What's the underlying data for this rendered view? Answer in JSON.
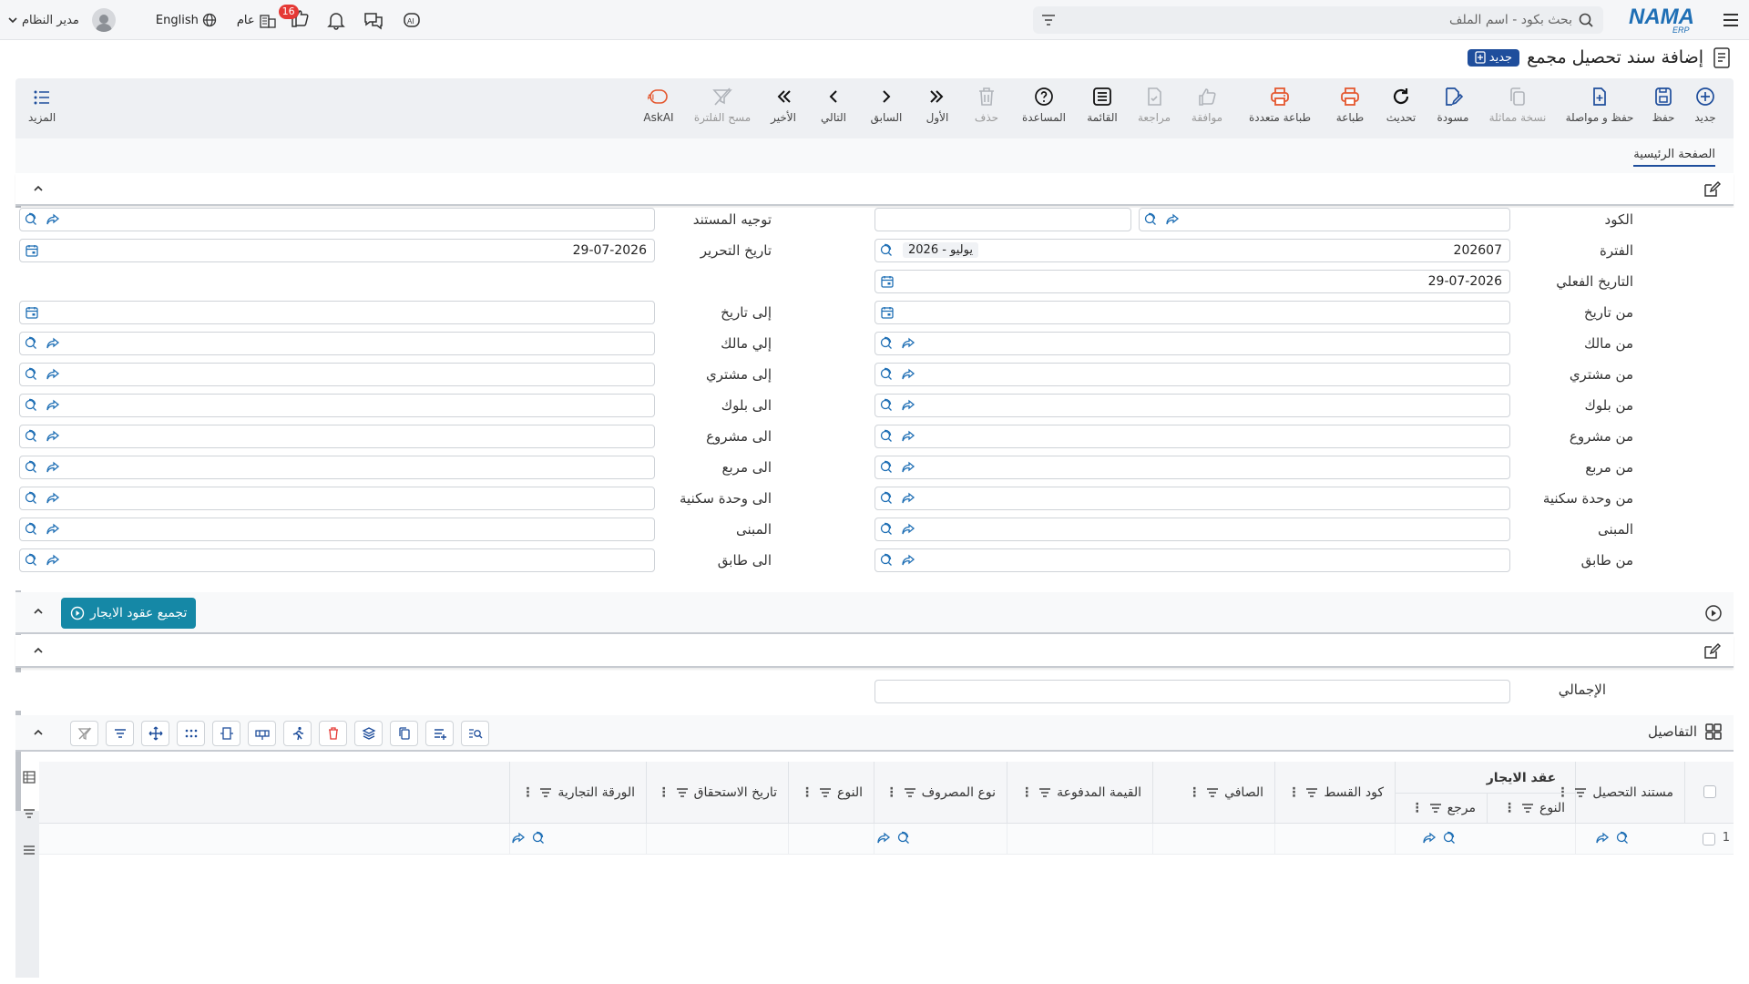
{
  "app": {
    "logo_text": "NAMA",
    "logo_sub": "ERP",
    "search_placeholder": "بحث بكود - اسم الملف",
    "user_name": "مدير النظام",
    "language": "English",
    "company": "عام",
    "likes_count": "16",
    "brand_color": "#1f4e9c"
  },
  "page": {
    "title": "إضافة سند تحصيل مجمع",
    "new_badge": "جديد"
  },
  "toolbar": {
    "items": [
      {
        "label": "جديد",
        "icon": "plus-circle-icon"
      },
      {
        "label": "حفظ",
        "icon": "save-icon"
      },
      {
        "label": "حفظ و مواصلة",
        "icon": "save-continue-icon"
      },
      {
        "label": "نسخة مماثلة",
        "icon": "copy-icon"
      },
      {
        "label": "مسودة",
        "icon": "draft-icon"
      },
      {
        "label": "تحديث",
        "icon": "refresh-icon"
      },
      {
        "label": "طباعة",
        "icon": "print-icon"
      },
      {
        "label": "طباعة متعددة",
        "icon": "multi-print-icon"
      },
      {
        "label": "موافقة",
        "icon": "approve-icon"
      },
      {
        "label": "مراجعة",
        "icon": "review-icon"
      },
      {
        "label": "القائمة",
        "icon": "list-icon"
      },
      {
        "label": "المساعدة",
        "icon": "help-icon"
      },
      {
        "label": "حذف",
        "icon": "trash-icon"
      },
      {
        "label": "الأول",
        "icon": "first-icon"
      },
      {
        "label": "السابق",
        "icon": "prev-icon"
      },
      {
        "label": "التالي",
        "icon": "next-icon"
      },
      {
        "label": "الأخير",
        "icon": "last-icon"
      },
      {
        "label": "مسح الفلترة",
        "icon": "clear-filter-icon"
      },
      {
        "label": "AskAI",
        "icon": "ai-icon"
      }
    ],
    "more_label": "المزيد"
  },
  "tabs": {
    "main": "الصفحة الرئيسية"
  },
  "form": {
    "right": [
      {
        "label": "الكود",
        "value": ""
      },
      {
        "label": "الفترة",
        "value": "202607",
        "tag": "2026 - يوليو"
      },
      {
        "label": "التاريخ الفعلي",
        "value": "29-07-2026"
      },
      {
        "label": "من تاريخ",
        "value": ""
      },
      {
        "label": "من مالك",
        "value": ""
      },
      {
        "label": "من مشتري",
        "value": ""
      },
      {
        "label": "من بلوك",
        "value": ""
      },
      {
        "label": "من مشروع",
        "value": ""
      },
      {
        "label": "من مربع",
        "value": ""
      },
      {
        "label": "من وحدة سكنية",
        "value": ""
      },
      {
        "label": "المبنى",
        "value": ""
      },
      {
        "label": "من طابق",
        "value": ""
      }
    ],
    "left": [
      {
        "label": "توجيه المستند",
        "value": ""
      },
      {
        "label": "تاريخ التحرير",
        "value": "29-07-2026"
      },
      {
        "label": "إلى تاريخ",
        "value": ""
      },
      {
        "label": "إلي مالك",
        "value": ""
      },
      {
        "label": "إلى مشتري",
        "value": ""
      },
      {
        "label": "الى بلوك",
        "value": ""
      },
      {
        "label": "الى مشروع",
        "value": ""
      },
      {
        "label": "الى مربع",
        "value": ""
      },
      {
        "label": "الى وحدة سكنية",
        "value": ""
      },
      {
        "label": "المبنى",
        "value": ""
      },
      {
        "label": "الى طابق",
        "value": ""
      }
    ]
  },
  "collect_button": "تجميع عقود الايجار",
  "total": {
    "label": "الإجمالي",
    "value": ""
  },
  "details": {
    "title": "التفاصيل",
    "columns": [
      "مستند التحصيل",
      "عقد الايجار",
      "النوع",
      "مرجع",
      "كود القسط",
      "الصافي",
      "القيمة المدفوعة",
      "نوع المصروف",
      "النوع",
      "تاريخ الاستحقاق",
      "الورقة التجارية"
    ],
    "row_number": "1"
  }
}
